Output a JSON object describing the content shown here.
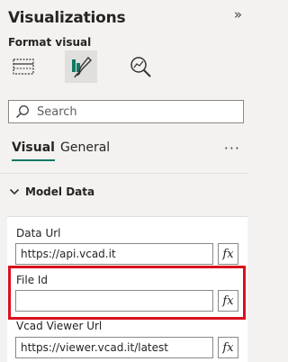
{
  "pane": {
    "title": "Visualizations",
    "subtitle": "Format visual",
    "collapse_glyph": "»"
  },
  "viz_tabs": [
    {
      "name": "build-visual",
      "icon": "table-grid-icon",
      "active": false
    },
    {
      "name": "format-visual",
      "icon": "paintbrush-chart-icon",
      "active": true
    },
    {
      "name": "analytics",
      "icon": "magnifier-chart-icon",
      "active": false
    }
  ],
  "search": {
    "placeholder": "Search",
    "value": ""
  },
  "tabs": [
    {
      "label": "Visual",
      "active": true
    },
    {
      "label": "General",
      "active": false
    }
  ],
  "more_glyph": "···",
  "section": {
    "label": "Model Data",
    "expanded": true
  },
  "fields": [
    {
      "label": "Data Url",
      "value": "https://api.vcad.it",
      "fx": "fx"
    },
    {
      "label": "File Id",
      "value": "",
      "fx": "fx"
    },
    {
      "label": "Vcad Viewer Url",
      "value": "https://viewer.vcad.it/latest",
      "fx": "fx"
    }
  ],
  "colors": {
    "accent": "#117865",
    "highlight": "#d9111e",
    "background": "#f3f2f1"
  }
}
